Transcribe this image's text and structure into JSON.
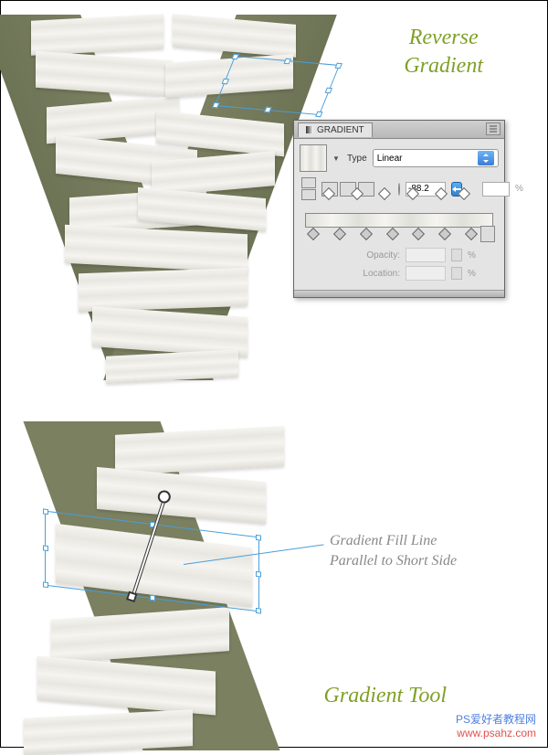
{
  "headings": {
    "reverse_line1": "Reverse",
    "reverse_line2": "Gradient",
    "tool": "Gradient Tool"
  },
  "panel": {
    "title": "GRADIENT",
    "type_label": "Type",
    "type_value": "Linear",
    "angle_value": "-88.2",
    "ratio_value": "",
    "opacity_label": "Opacity:",
    "location_label": "Location:",
    "percent": "%"
  },
  "callout": {
    "line1": "Gradient Fill Line",
    "line2": "Parallel to Short Side"
  },
  "watermark": {
    "line1": "PS爱好者教程网",
    "line2": "www.psahz.com"
  },
  "chart_data": {
    "type": "other",
    "note": "Adobe Illustrator tutorial screenshot showing gradient panel"
  }
}
